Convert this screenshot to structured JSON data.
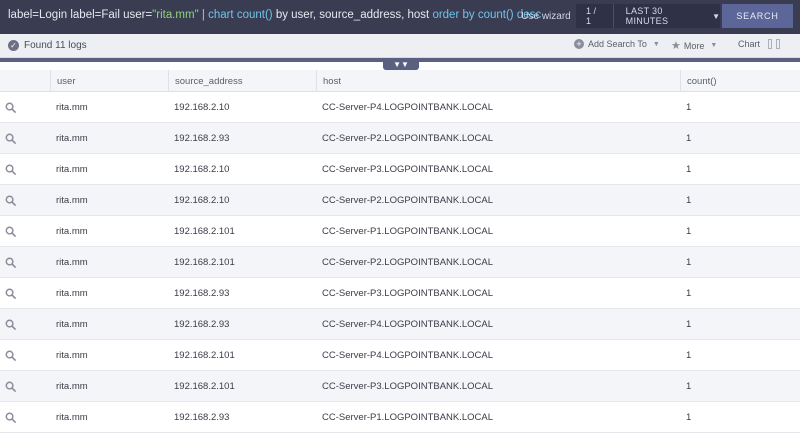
{
  "query": {
    "part1": "label=Login label=Fail  user=",
    "user_value": "\"rita.mm\"",
    "pipe": "  | ",
    "cmd1": "chart count()",
    "by1": " by user, source_address, host ",
    "cmd2": "order by count()",
    "dir": " desc"
  },
  "toolbar": {
    "wizard_label": "Use wizard",
    "page_indicator": "1 / 1",
    "time_range": "LAST 30 MINUTES",
    "search_label": "SEARCH"
  },
  "status": {
    "found_text": "Found 11 logs",
    "add_search_label": "Add Search To",
    "more_label": "More",
    "chart_label": "Chart"
  },
  "table": {
    "columns": [
      "user",
      "source_address",
      "host",
      "count()"
    ],
    "rows": [
      {
        "user": "rita.mm",
        "source_address": "192.168.2.10",
        "host": "CC-Server-P4.LOGPOINTBANK.LOCAL",
        "count": "1"
      },
      {
        "user": "rita.mm",
        "source_address": "192.168.2.93",
        "host": "CC-Server-P2.LOGPOINTBANK.LOCAL",
        "count": "1"
      },
      {
        "user": "rita.mm",
        "source_address": "192.168.2.10",
        "host": "CC-Server-P3.LOGPOINTBANK.LOCAL",
        "count": "1"
      },
      {
        "user": "rita.mm",
        "source_address": "192.168.2.10",
        "host": "CC-Server-P2.LOGPOINTBANK.LOCAL",
        "count": "1"
      },
      {
        "user": "rita.mm",
        "source_address": "192.168.2.101",
        "host": "CC-Server-P1.LOGPOINTBANK.LOCAL",
        "count": "1"
      },
      {
        "user": "rita.mm",
        "source_address": "192.168.2.101",
        "host": "CC-Server-P2.LOGPOINTBANK.LOCAL",
        "count": "1"
      },
      {
        "user": "rita.mm",
        "source_address": "192.168.2.93",
        "host": "CC-Server-P3.LOGPOINTBANK.LOCAL",
        "count": "1"
      },
      {
        "user": "rita.mm",
        "source_address": "192.168.2.93",
        "host": "CC-Server-P4.LOGPOINTBANK.LOCAL",
        "count": "1"
      },
      {
        "user": "rita.mm",
        "source_address": "192.168.2.101",
        "host": "CC-Server-P4.LOGPOINTBANK.LOCAL",
        "count": "1"
      },
      {
        "user": "rita.mm",
        "source_address": "192.168.2.101",
        "host": "CC-Server-P3.LOGPOINTBANK.LOCAL",
        "count": "1"
      },
      {
        "user": "rita.mm",
        "source_address": "192.168.2.93",
        "host": "CC-Server-P1.LOGPOINTBANK.LOCAL",
        "count": "1"
      }
    ]
  },
  "colors": {
    "topbar": "#3a3d52",
    "string_literal": "#8fd37a",
    "keyword": "#6ec3ea",
    "search_button": "#5d6698",
    "row_alt": "#f4f5f8"
  },
  "icons": [
    "check-icon",
    "plus-icon",
    "star-icon",
    "chevron-down-icon",
    "magnifier-icon"
  ]
}
